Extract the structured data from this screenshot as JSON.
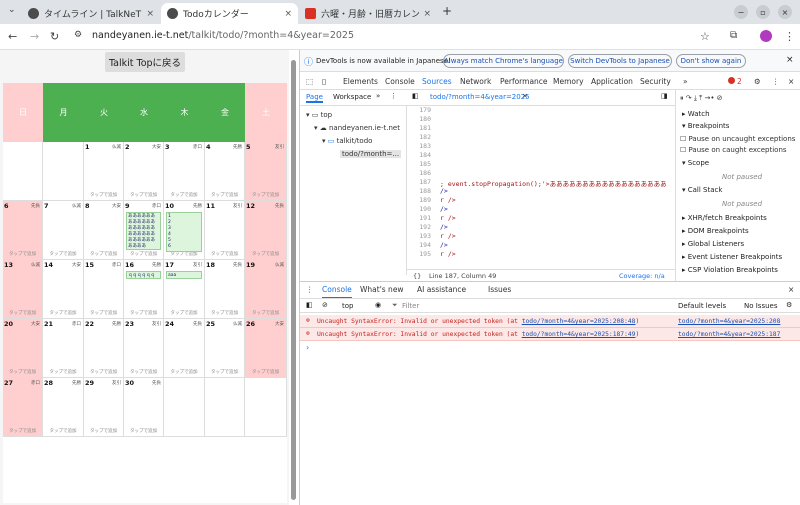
{
  "tabs": [
    {
      "title": "タイムライン | TalkNeT",
      "close": "×",
      "color": "#4b4b4b"
    },
    {
      "title": "Todoカレンダー",
      "close": "×",
      "color": "#4b4b4b"
    },
    {
      "title": "六曜・月齢・旧暦カレン",
      "close": "×",
      "color": "#d93025"
    }
  ],
  "new_tab": "+",
  "window": {
    "minimize": "−",
    "restore": "▫",
    "close": "×",
    "dropdown": "⌄"
  },
  "url": {
    "host": "nandeyanen.ie-t.net",
    "path": "/talkit/todo/?month=4&year=2025"
  },
  "page": {
    "top_button": "Talkit Topに戻る",
    "weekdays": [
      "日",
      "月",
      "火",
      "水",
      "木",
      "金",
      "土"
    ],
    "header_colors": {
      "sun": "#ffcfcf",
      "weekday": "#4caf50",
      "sat": "#ffcfcf"
    },
    "tap_text": "タップで追加",
    "weeks": [
      [
        {
          "d": "",
          "r": ""
        },
        {
          "d": "",
          "r": ""
        },
        {
          "d": "1",
          "r": "仏滅"
        },
        {
          "d": "2",
          "r": "大安"
        },
        {
          "d": "3",
          "r": "赤口"
        },
        {
          "d": "4",
          "r": "先勝"
        },
        {
          "d": "5",
          "r": "友引"
        }
      ],
      [
        {
          "d": "6",
          "r": "先負"
        },
        {
          "d": "7",
          "r": "仏滅"
        },
        {
          "d": "8",
          "r": "大安"
        },
        {
          "d": "9",
          "r": "赤口"
        },
        {
          "d": "10",
          "r": "先勝"
        },
        {
          "d": "11",
          "r": "友引"
        },
        {
          "d": "12",
          "r": "先負"
        }
      ],
      [
        {
          "d": "13",
          "r": "仏滅"
        },
        {
          "d": "14",
          "r": "大安"
        },
        {
          "d": "15",
          "r": "赤口"
        },
        {
          "d": "16",
          "r": "先勝"
        },
        {
          "d": "17",
          "r": "友引"
        },
        {
          "d": "18",
          "r": "先負"
        },
        {
          "d": "19",
          "r": "仏滅"
        }
      ],
      [
        {
          "d": "20",
          "r": "大安"
        },
        {
          "d": "21",
          "r": "赤口"
        },
        {
          "d": "22",
          "r": "先勝"
        },
        {
          "d": "23",
          "r": "友引"
        },
        {
          "d": "24",
          "r": "先負"
        },
        {
          "d": "25",
          "r": "仏滅"
        },
        {
          "d": "26",
          "r": "大安"
        }
      ],
      [
        {
          "d": "27",
          "r": "赤口"
        },
        {
          "d": "28",
          "r": "先勝"
        },
        {
          "d": "29",
          "r": "友引"
        },
        {
          "d": "30",
          "r": "先負"
        },
        {
          "d": "",
          "r": ""
        },
        {
          "d": "",
          "r": ""
        },
        {
          "d": "",
          "r": ""
        }
      ]
    ],
    "todo_9": "ああああああああああああああああああああああああああああああああああ",
    "todo_10": "1\n2\n3\n4\n5\n6",
    "todo_16": "ｑｑｑｑｑｑ",
    "todo_17": "aaa"
  },
  "devtools": {
    "notice": "DevTools is now available in Japanese!",
    "btn_match": "Always match Chrome's language",
    "btn_switch": "Switch DevTools to Japanese",
    "btn_dont": "Don't show again",
    "tabs": [
      "Elements",
      "Console",
      "Sources",
      "Network",
      "Performance",
      "Memory",
      "Application",
      "Security"
    ],
    "more": "»",
    "error_count": "2",
    "src_tabs": [
      "Page",
      "Workspace"
    ],
    "open_file": "todo/?month=4&year=2025",
    "tree": [
      "top",
      "nandeyanen.ie-t.net",
      "talkit/todo",
      "todo/?month=..."
    ],
    "line_numbers": [
      "179",
      "180",
      "181",
      "182",
      "183",
      "184",
      "185",
      "186",
      "187",
      "188",
      "189",
      "190",
      "191",
      "192",
      "193",
      "194",
      "195"
    ],
    "line_187": "; event.stopPropagation();'>ああああああああああああああああああ",
    "line_188": " />",
    "line_189": "r />",
    "line_190": " />",
    "line_191": "r />",
    "line_192": " />",
    "line_193": "r />",
    "line_194": " />",
    "line_195": "r />",
    "status": "Line 187, Column 49",
    "coverage": "Coverage: n/a",
    "right": {
      "watch": "Watch",
      "breakpoints": "Breakpoints",
      "pause_uncaught": "Pause on uncaught exceptions",
      "pause_caught": "Pause on caught exceptions",
      "scope": "Scope",
      "not_paused": "Not paused",
      "call_stack": "Call Stack",
      "not_paused2": "Not paused",
      "xhr": "XHR/fetch Breakpoints",
      "dom": "DOM Breakpoints",
      "global": "Global Listeners",
      "event": "Event Listener Breakpoints",
      "csp": "CSP Violation Breakpoints"
    },
    "console": {
      "tabs": [
        "Console",
        "What's new",
        "AI assistance",
        "Issues"
      ],
      "context": "top",
      "filter": "Filter",
      "levels": "Default levels",
      "issues": "No Issues",
      "prompt": "›",
      "errors": [
        {
          "msg": "Uncaught SyntaxError: Invalid or unexpected token (at ",
          "link": "todo/?month=4&year=2025:208:48",
          "end": ")",
          "src": "todo/?month=4&year=2025:208"
        },
        {
          "msg": "Uncaught SyntaxError: Invalid or unexpected token (at ",
          "link": "todo/?month=4&year=2025:187:49",
          "end": ")",
          "src": "todo/?month=4&year=2025:187"
        }
      ]
    }
  }
}
